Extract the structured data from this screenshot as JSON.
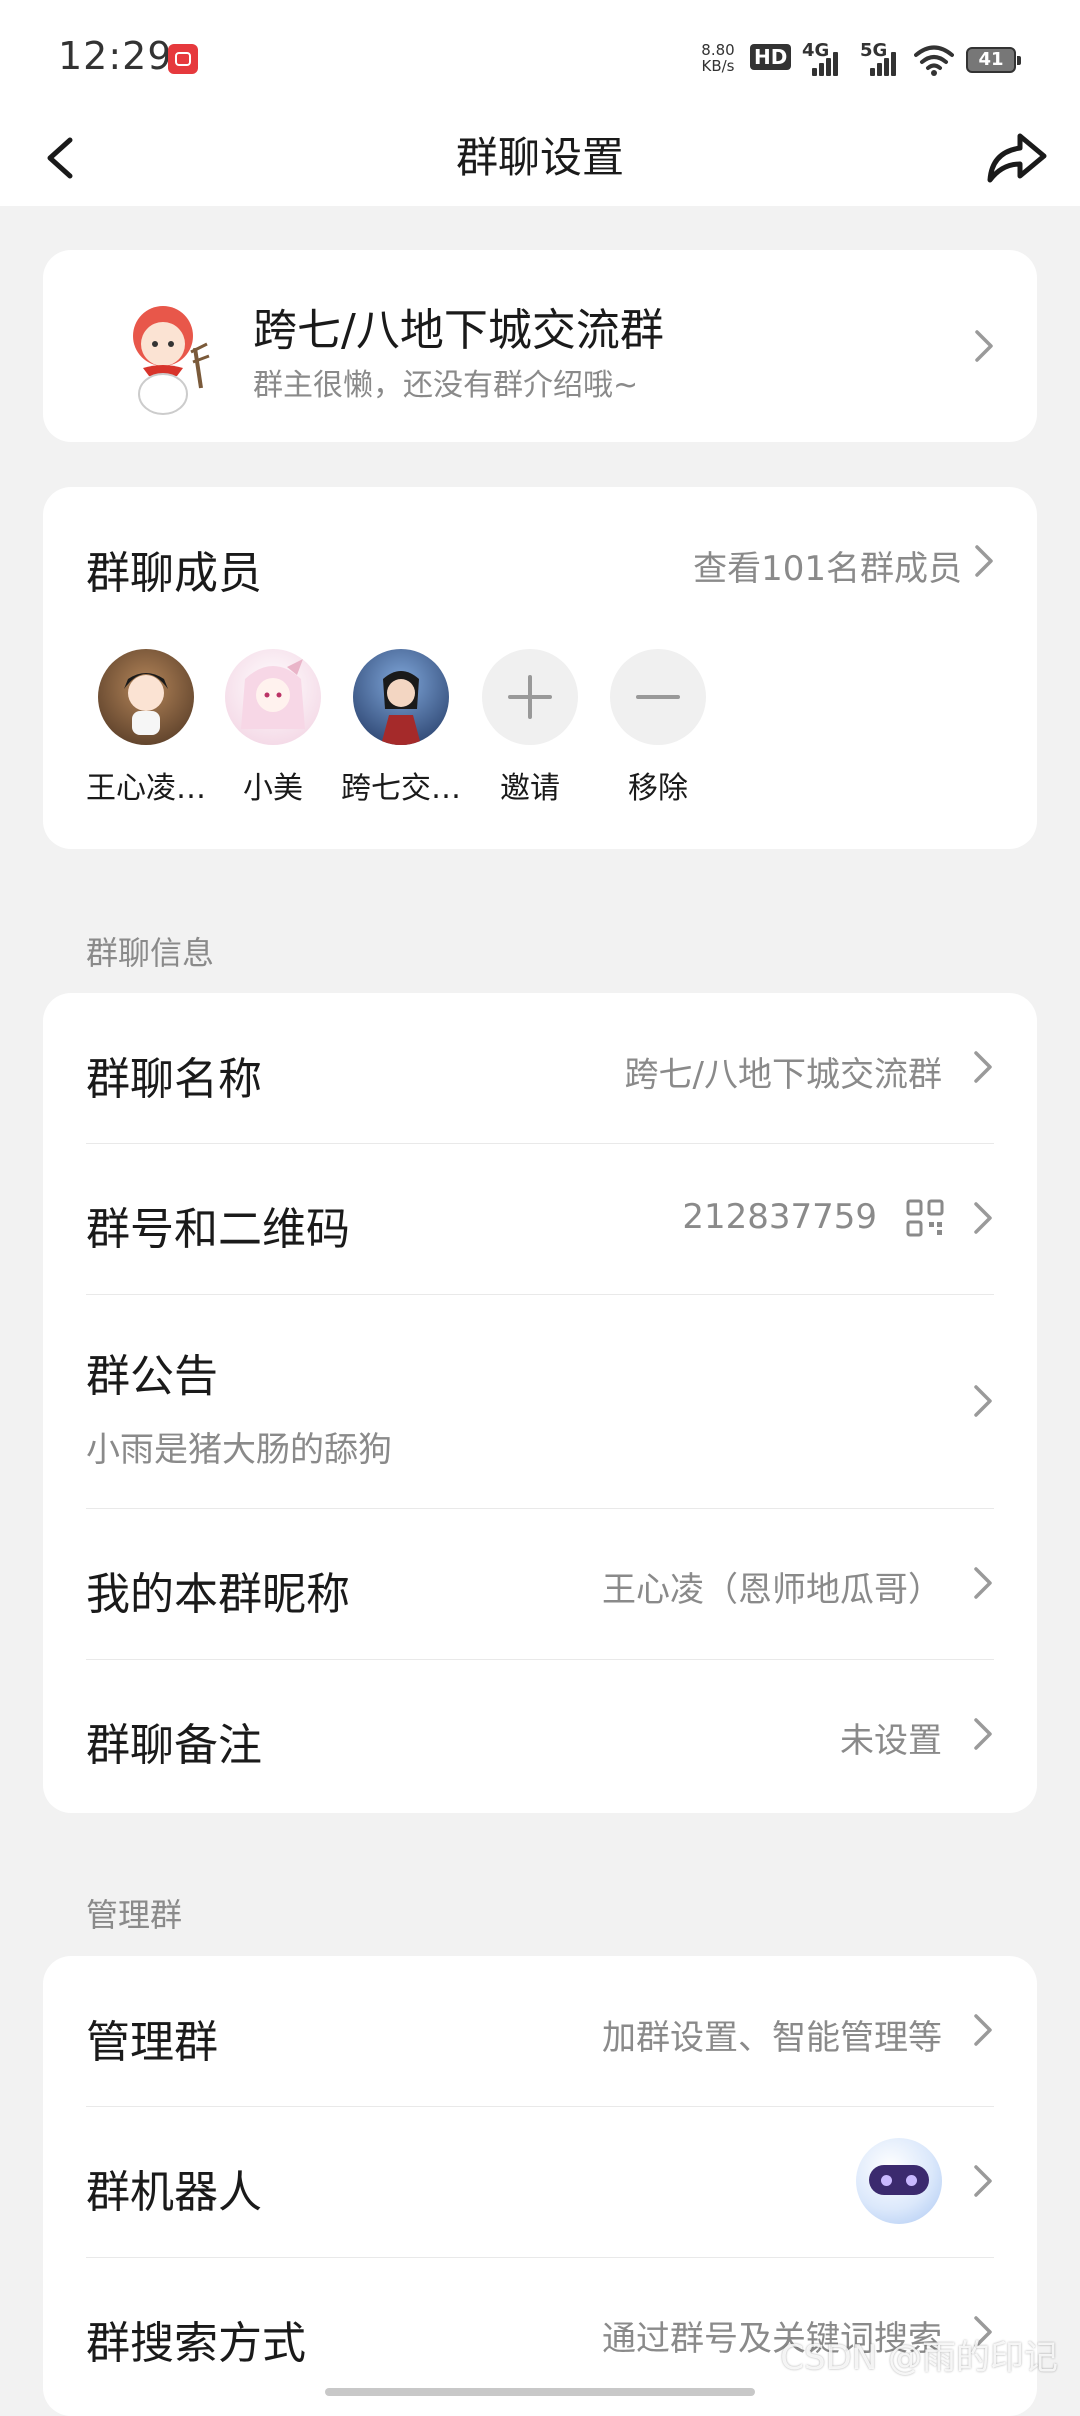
{
  "status_bar": {
    "time": "12:29",
    "net_speed_value": "8.80",
    "net_speed_unit": "KB/s",
    "hd_label": "HD",
    "sig1_label": "4G",
    "sig2_label": "5G",
    "battery": "41"
  },
  "nav": {
    "title": "群聊设置",
    "back_icon": "back-arrow-icon",
    "share_icon": "share-arrow-icon"
  },
  "group": {
    "name": "跨七/八地下城交流群",
    "description": "群主很懒，还没有群介绍哦~"
  },
  "members": {
    "title": "群聊成员",
    "view_all": "查看101名群成员",
    "list": [
      {
        "label": "王心凌…",
        "color": "#6a4a2e"
      },
      {
        "label": "小美",
        "color": "#f3d6e4"
      },
      {
        "label": "跨七交…",
        "color": "#2d4a7a"
      }
    ],
    "invite_label": "邀请",
    "remove_label": "移除"
  },
  "info_section": {
    "label": "群聊信息",
    "name_label": "群聊名称",
    "name_value": "跨七/八地下城交流群",
    "number_label": "群号和二维码",
    "number_value": "212837759",
    "notice_label": "群公告",
    "notice_value": "小雨是猪大肠的舔狗",
    "nickname_label": "我的本群昵称",
    "nickname_value": "王心凌（恩师地瓜哥）",
    "remark_label": "群聊备注",
    "remark_value": "未设置"
  },
  "manage_section": {
    "label": "管理群",
    "manage_label": "管理群",
    "manage_value": "加群设置、智能管理等",
    "robot_label": "群机器人",
    "search_label": "群搜索方式",
    "search_value": "通过群号及关键词搜索"
  },
  "watermark": "CSDN @雨的印记"
}
